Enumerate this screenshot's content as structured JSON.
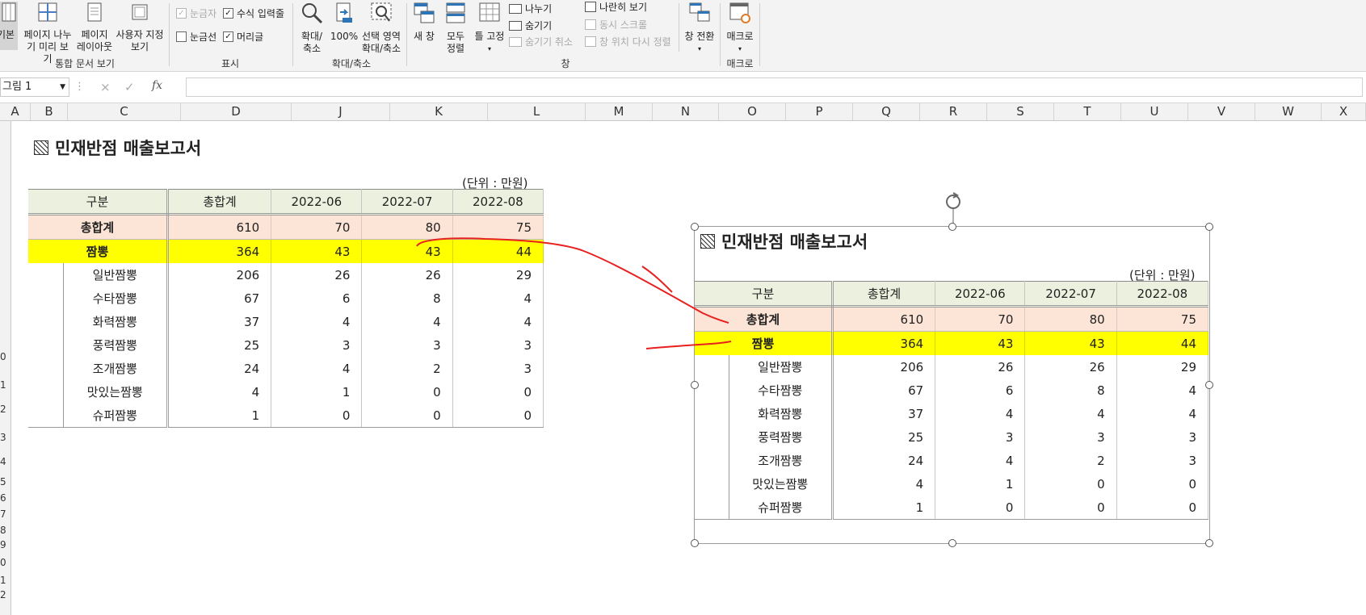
{
  "ribbon": {
    "view_group": {
      "normal_label": "기본",
      "page_break_label_1": "페이지 나누",
      "page_break_label_2": "기 미리 보기",
      "page_layout_label_1": "페이지",
      "page_layout_label_2": "레이아웃",
      "custom_view_label_1": "사용자 지정",
      "custom_view_label_2": "보기",
      "group_label": "통합 문서 보기"
    },
    "show_group": {
      "ruler": "눈금자",
      "formula_bar": "수식 입력줄",
      "gridlines": "눈금선",
      "headings": "머리글",
      "group_label": "표시"
    },
    "zoom_group": {
      "zoom_label_1": "확대/",
      "zoom_label_2": "축소",
      "zoom100_label": "100%",
      "zoom_sel_label_1": "선택 영역",
      "zoom_sel_label_2": "확대/축소",
      "group_label": "확대/축소"
    },
    "window_group": {
      "new_window": "새 창",
      "arrange_1": "모두",
      "arrange_2": "정렬",
      "freeze_1": "틀 고정",
      "split": "나누기",
      "hide": "숨기기",
      "unhide": "숨기기 취소",
      "side_by_side": "나란히 보기",
      "sync_scroll": "동시 스크롤",
      "reset_pos": "창 위치 다시 정렬",
      "switch": "창 전환",
      "group_label": "창"
    },
    "macro_group": {
      "macro": "매크로",
      "group_label": "매크로"
    }
  },
  "formula_bar": {
    "name_box": "그림 1",
    "cancel_icon": "×",
    "enter_icon": "✓",
    "fx": "fx",
    "formula": ""
  },
  "columns": [
    "A",
    "B",
    "C",
    "D",
    "J",
    "K",
    "L",
    "M",
    "N",
    "O",
    "P",
    "Q",
    "R",
    "S",
    "T",
    "U",
    "V",
    "W",
    "X"
  ],
  "rows": [
    "",
    "",
    "",
    "",
    "",
    "",
    "",
    "",
    "",
    "0",
    "1",
    "2",
    "3",
    "4",
    "5",
    "6",
    "7",
    "8",
    "9",
    "0",
    "1",
    "2"
  ],
  "report": {
    "title": "민재반점 매출보고서",
    "unit": "(단위 : 만원)",
    "headers": [
      "구분",
      "총합계",
      "2022-06",
      "2022-07",
      "2022-08"
    ],
    "total_row": {
      "label": "총합계",
      "values": [
        "610",
        "70",
        "80",
        "75"
      ]
    },
    "highlight_row": {
      "label": "짬뽕",
      "values": [
        "364",
        "43",
        "43",
        "44"
      ]
    },
    "sub_rows": [
      {
        "label": "일반짬뽕",
        "values": [
          "206",
          "26",
          "26",
          "29"
        ]
      },
      {
        "label": "수타짬뽕",
        "values": [
          "67",
          "6",
          "8",
          "4"
        ]
      },
      {
        "label": "화력짬뽕",
        "values": [
          "37",
          "4",
          "4",
          "4"
        ]
      },
      {
        "label": "풍력짬뽕",
        "values": [
          "25",
          "3",
          "3",
          "3"
        ]
      },
      {
        "label": "조개짬뽕",
        "values": [
          "24",
          "4",
          "2",
          "3"
        ]
      },
      {
        "label": "맛있는짬뽕",
        "values": [
          "4",
          "1",
          "0",
          "0"
        ]
      },
      {
        "label": "슈퍼짬뽕",
        "values": [
          "1",
          "0",
          "0",
          "0"
        ]
      }
    ]
  },
  "colors": {
    "header_bg": "#ebf1de",
    "total_bg": "#fce4d6",
    "highlight_bg": "#ffff00",
    "annotation": "#e8201e"
  }
}
